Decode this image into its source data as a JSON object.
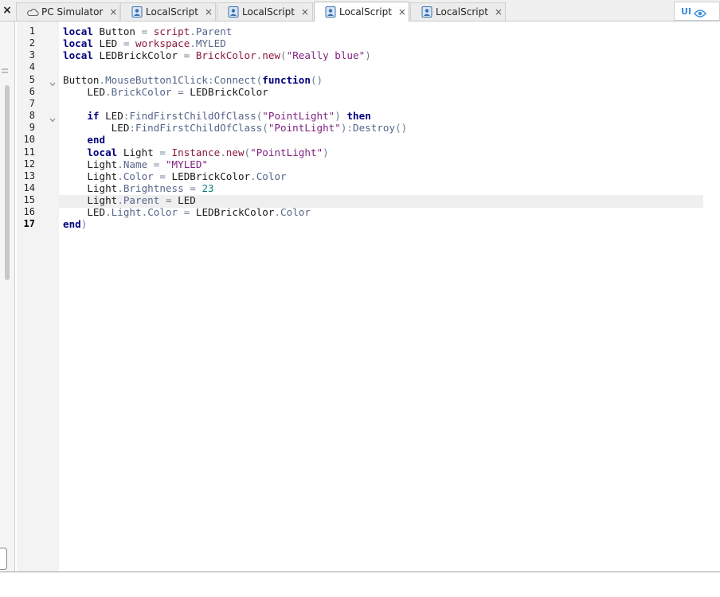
{
  "tabbar": {
    "close_all": "×",
    "tabs": [
      {
        "label": "PC Simulator",
        "close": "×",
        "icon": "cloud-icon"
      },
      {
        "label": "LocalScript",
        "close": "×",
        "icon": "script-icon"
      },
      {
        "label": "LocalScript",
        "close": "×",
        "icon": "script-icon"
      },
      {
        "label": "LocalScript",
        "close": "×",
        "icon": "script-icon",
        "active": true
      },
      {
        "label": "LocalScript",
        "close": "×",
        "icon": "script-icon"
      }
    ],
    "ui_toggle": {
      "label": "UI",
      "icon": "eye-icon"
    }
  },
  "editor": {
    "current_line": 17,
    "line_numbers": [
      "1",
      "2",
      "3",
      "4",
      "5",
      "6",
      "7",
      "8",
      "9",
      "10",
      "11",
      "12",
      "13",
      "14",
      "15",
      "16",
      "17"
    ],
    "fold_lines": [
      5,
      8
    ],
    "lines": [
      [
        [
          "kw",
          "local"
        ],
        [
          "id",
          " Button "
        ],
        [
          "op",
          "="
        ],
        [
          "id",
          " "
        ],
        [
          "bi",
          "script"
        ],
        [
          "op",
          "."
        ],
        [
          "prop",
          "Parent"
        ]
      ],
      [
        [
          "kw",
          "local"
        ],
        [
          "id",
          " LED "
        ],
        [
          "op",
          "="
        ],
        [
          "id",
          " "
        ],
        [
          "bi",
          "workspace"
        ],
        [
          "op",
          "."
        ],
        [
          "prop",
          "MYLED"
        ]
      ],
      [
        [
          "kw",
          "local"
        ],
        [
          "id",
          " LEDBrickColor "
        ],
        [
          "op",
          "="
        ],
        [
          "id",
          " "
        ],
        [
          "bi",
          "BrickColor"
        ],
        [
          "op",
          "."
        ],
        [
          "bi",
          "new"
        ],
        [
          "op",
          "("
        ],
        [
          "str",
          "\"Really blue\""
        ],
        [
          "op",
          ")"
        ]
      ],
      [],
      [
        [
          "id",
          "Button"
        ],
        [
          "op",
          "."
        ],
        [
          "prop",
          "MouseButton1Click"
        ],
        [
          "op",
          ":"
        ],
        [
          "prop",
          "Connect"
        ],
        [
          "op",
          "("
        ],
        [
          "kw",
          "function"
        ],
        [
          "op",
          "()"
        ]
      ],
      [
        [
          "id",
          "    LED"
        ],
        [
          "op",
          "."
        ],
        [
          "prop",
          "BrickColor"
        ],
        [
          "id",
          " "
        ],
        [
          "op",
          "="
        ],
        [
          "id",
          " LEDBrickColor"
        ]
      ],
      [],
      [
        [
          "id",
          "    "
        ],
        [
          "kw",
          "if"
        ],
        [
          "id",
          " LED"
        ],
        [
          "op",
          ":"
        ],
        [
          "prop",
          "FindFirstChildOfClass"
        ],
        [
          "op",
          "("
        ],
        [
          "str",
          "\"PointLight\""
        ],
        [
          "op",
          ")"
        ],
        [
          "id",
          " "
        ],
        [
          "kw",
          "then"
        ]
      ],
      [
        [
          "id",
          "        LED"
        ],
        [
          "op",
          ":"
        ],
        [
          "prop",
          "FindFirstChildOfClass"
        ],
        [
          "op",
          "("
        ],
        [
          "str",
          "\"PointLight\""
        ],
        [
          "op",
          "):"
        ],
        [
          "prop",
          "Destroy"
        ],
        [
          "op",
          "()"
        ]
      ],
      [
        [
          "id",
          "    "
        ],
        [
          "kw",
          "end"
        ]
      ],
      [
        [
          "id",
          "    "
        ],
        [
          "kw",
          "local"
        ],
        [
          "id",
          " Light "
        ],
        [
          "op",
          "="
        ],
        [
          "id",
          " "
        ],
        [
          "bi",
          "Instance"
        ],
        [
          "op",
          "."
        ],
        [
          "bi",
          "new"
        ],
        [
          "op",
          "("
        ],
        [
          "str",
          "\"PointLight\""
        ],
        [
          "op",
          ")"
        ]
      ],
      [
        [
          "id",
          "    Light"
        ],
        [
          "op",
          "."
        ],
        [
          "prop",
          "Name"
        ],
        [
          "id",
          " "
        ],
        [
          "op",
          "="
        ],
        [
          "id",
          " "
        ],
        [
          "str",
          "\"MYLED\""
        ]
      ],
      [
        [
          "id",
          "    Light"
        ],
        [
          "op",
          "."
        ],
        [
          "prop",
          "Color"
        ],
        [
          "id",
          " "
        ],
        [
          "op",
          "="
        ],
        [
          "id",
          " LEDBrickColor"
        ],
        [
          "op",
          "."
        ],
        [
          "prop",
          "Color"
        ]
      ],
      [
        [
          "id",
          "    Light"
        ],
        [
          "op",
          "."
        ],
        [
          "prop",
          "Brightness"
        ],
        [
          "id",
          " "
        ],
        [
          "op",
          "="
        ],
        [
          "id",
          " "
        ],
        [
          "num",
          "23"
        ]
      ],
      [
        [
          "id",
          "    Light"
        ],
        [
          "op",
          "."
        ],
        [
          "prop",
          "Parent"
        ],
        [
          "id",
          " "
        ],
        [
          "op",
          "="
        ],
        [
          "id",
          " LED"
        ]
      ],
      [
        [
          "id",
          "    LED"
        ],
        [
          "op",
          "."
        ],
        [
          "prop",
          "Light"
        ],
        [
          "op",
          "."
        ],
        [
          "prop",
          "Color"
        ],
        [
          "id",
          " "
        ],
        [
          "op",
          "="
        ],
        [
          "id",
          " LEDBrickColor"
        ],
        [
          "op",
          "."
        ],
        [
          "prop",
          "Color"
        ]
      ],
      [
        [
          "kw",
          "end"
        ],
        [
          "op",
          ")"
        ]
      ]
    ]
  },
  "colors": {
    "keyword": "#00007f",
    "string": "#7f1f7f",
    "number": "#0d7d7d",
    "accent": "#3b8fd9"
  }
}
